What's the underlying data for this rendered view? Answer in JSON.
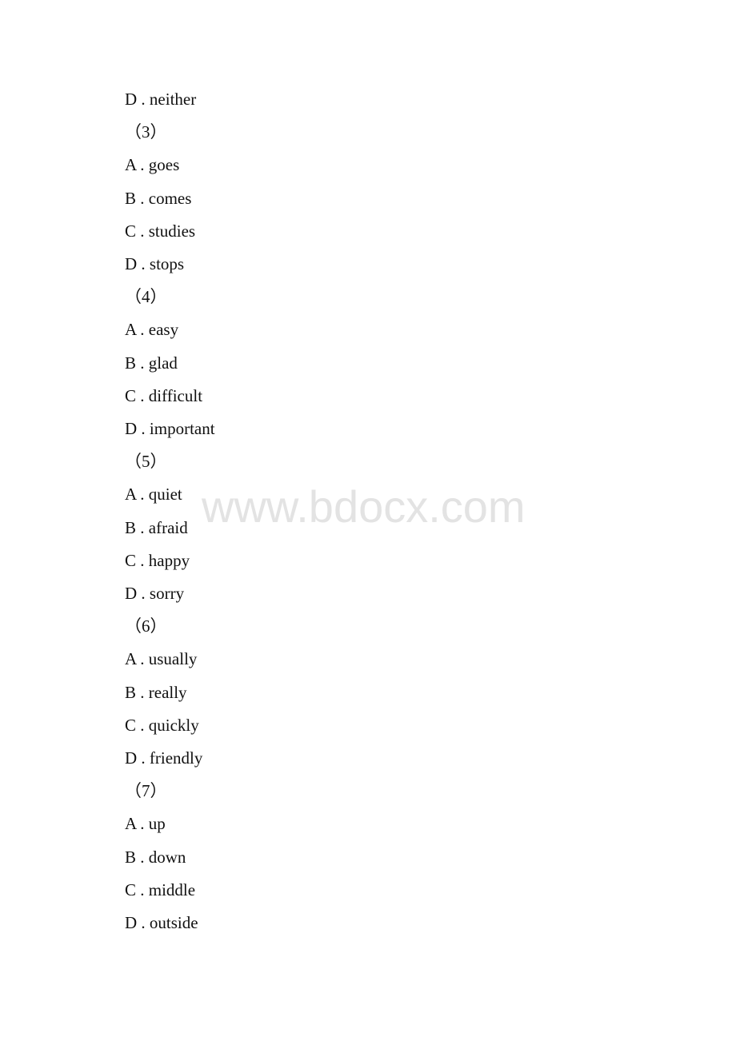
{
  "lines": [
    {
      "type": "option",
      "text": "D . neither"
    },
    {
      "type": "question",
      "text": "（3）"
    },
    {
      "type": "option",
      "text": "A . goes"
    },
    {
      "type": "option",
      "text": "B . comes"
    },
    {
      "type": "option",
      "text": "C . studies"
    },
    {
      "type": "option",
      "text": "D . stops"
    },
    {
      "type": "question",
      "text": "（4）"
    },
    {
      "type": "option",
      "text": "A . easy"
    },
    {
      "type": "option",
      "text": "B . glad"
    },
    {
      "type": "option",
      "text": "C . difficult"
    },
    {
      "type": "option",
      "text": "D . important"
    },
    {
      "type": "question",
      "text": "（5）"
    },
    {
      "type": "option",
      "text": "A . quiet"
    },
    {
      "type": "option",
      "text": "B . afraid"
    },
    {
      "type": "option",
      "text": "C . happy"
    },
    {
      "type": "option",
      "text": "D . sorry"
    },
    {
      "type": "question",
      "text": "（6）"
    },
    {
      "type": "option",
      "text": "A . usually"
    },
    {
      "type": "option",
      "text": "B . really"
    },
    {
      "type": "option",
      "text": "C . quickly"
    },
    {
      "type": "option",
      "text": "D . friendly"
    },
    {
      "type": "question",
      "text": "（7）"
    },
    {
      "type": "option",
      "text": "A . up"
    },
    {
      "type": "option",
      "text": "B . down"
    },
    {
      "type": "option",
      "text": "C . middle"
    },
    {
      "type": "option",
      "text": "D . outside"
    }
  ],
  "watermark": "www.bdocx.com"
}
